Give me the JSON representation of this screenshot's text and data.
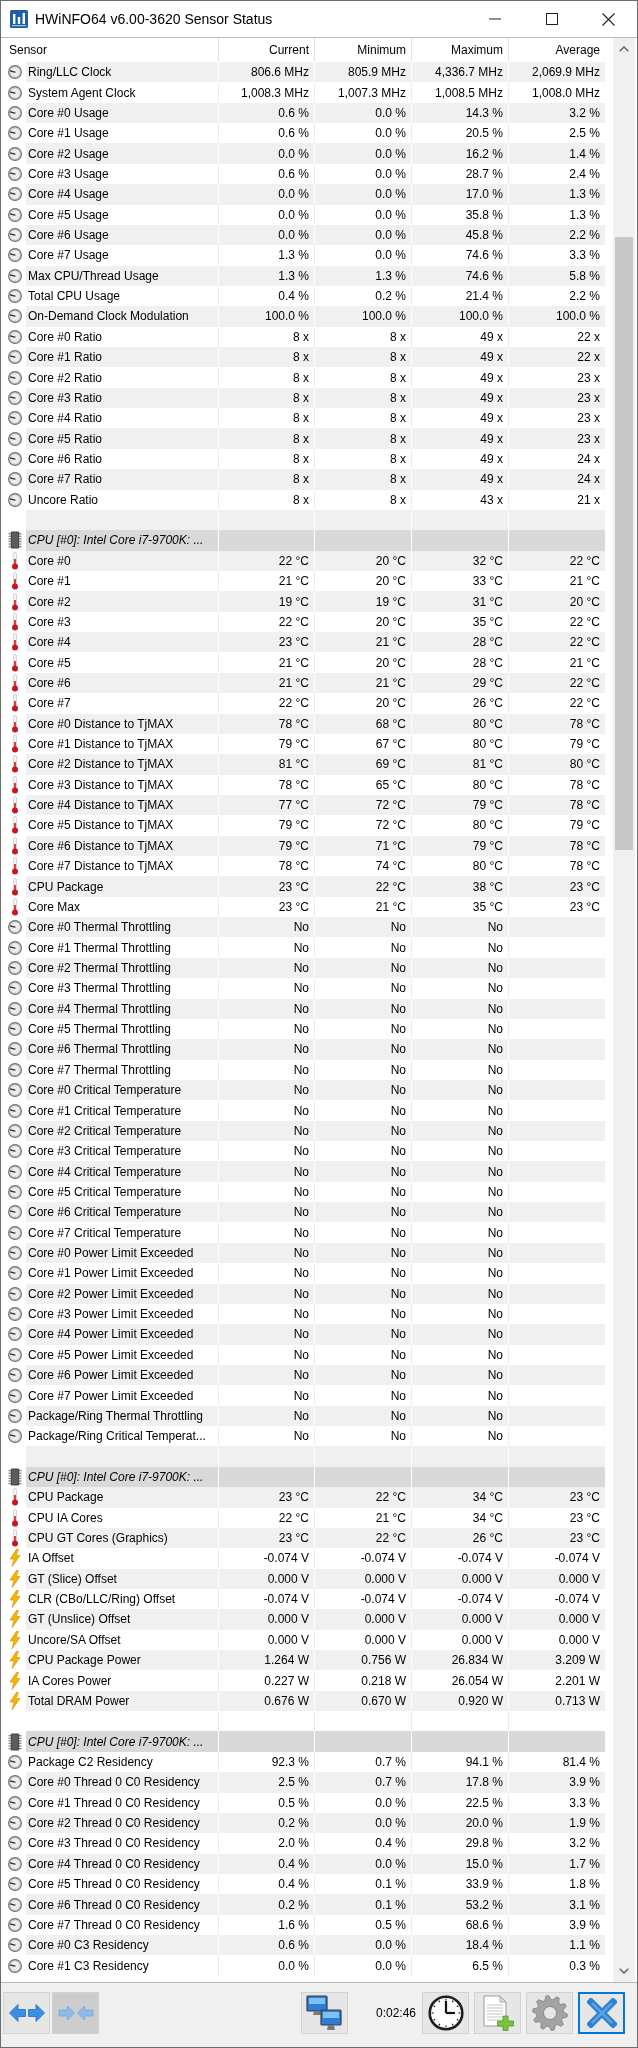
{
  "window": {
    "title": "HWiNFO64 v6.00-3620 Sensor Status"
  },
  "table": {
    "columns": [
      "Sensor",
      "Current",
      "Minimum",
      "Maximum",
      "Average"
    ],
    "sections": [
      {
        "rows": [
          {
            "kind": "gauge",
            "sensor": "Ring/LLC Clock",
            "values": [
              "806.6 MHz",
              "805.9 MHz",
              "4,336.7 MHz",
              "2,069.9 MHz"
            ]
          },
          {
            "kind": "gauge",
            "sensor": "System Agent Clock",
            "values": [
              "1,008.3 MHz",
              "1,007.3 MHz",
              "1,008.5 MHz",
              "1,008.0 MHz"
            ]
          },
          {
            "kind": "gauge",
            "sensor": "Core #0 Usage",
            "values": [
              "0.6 %",
              "0.0 %",
              "14.3 %",
              "3.2 %"
            ]
          },
          {
            "kind": "gauge",
            "sensor": "Core #1 Usage",
            "values": [
              "0.6 %",
              "0.0 %",
              "20.5 %",
              "2.5 %"
            ]
          },
          {
            "kind": "gauge",
            "sensor": "Core #2 Usage",
            "values": [
              "0.0 %",
              "0.0 %",
              "16.2 %",
              "1.4 %"
            ]
          },
          {
            "kind": "gauge",
            "sensor": "Core #3 Usage",
            "values": [
              "0.6 %",
              "0.0 %",
              "28.7 %",
              "2.4 %"
            ]
          },
          {
            "kind": "gauge",
            "sensor": "Core #4 Usage",
            "values": [
              "0.0 %",
              "0.0 %",
              "17.0 %",
              "1.3 %"
            ]
          },
          {
            "kind": "gauge",
            "sensor": "Core #5 Usage",
            "values": [
              "0.0 %",
              "0.0 %",
              "35.8 %",
              "1.3 %"
            ]
          },
          {
            "kind": "gauge",
            "sensor": "Core #6 Usage",
            "values": [
              "0.0 %",
              "0.0 %",
              "45.8 %",
              "2.2 %"
            ]
          },
          {
            "kind": "gauge",
            "sensor": "Core #7 Usage",
            "values": [
              "1.3 %",
              "0.0 %",
              "74.6 %",
              "3.3 %"
            ]
          },
          {
            "kind": "gauge",
            "sensor": "Max CPU/Thread Usage",
            "values": [
              "1.3 %",
              "1.3 %",
              "74.6 %",
              "5.8 %"
            ]
          },
          {
            "kind": "gauge",
            "sensor": "Total CPU Usage",
            "values": [
              "0.4 %",
              "0.2 %",
              "21.4 %",
              "2.2 %"
            ]
          },
          {
            "kind": "gauge",
            "sensor": "On-Demand Clock Modulation",
            "values": [
              "100.0 %",
              "100.0 %",
              "100.0 %",
              "100.0 %"
            ]
          },
          {
            "kind": "gauge",
            "sensor": "Core #0 Ratio",
            "values": [
              "8 x",
              "8 x",
              "49 x",
              "22 x"
            ]
          },
          {
            "kind": "gauge",
            "sensor": "Core #1 Ratio",
            "values": [
              "8 x",
              "8 x",
              "49 x",
              "22 x"
            ]
          },
          {
            "kind": "gauge",
            "sensor": "Core #2 Ratio",
            "values": [
              "8 x",
              "8 x",
              "49 x",
              "23 x"
            ]
          },
          {
            "kind": "gauge",
            "sensor": "Core #3 Ratio",
            "values": [
              "8 x",
              "8 x",
              "49 x",
              "23 x"
            ]
          },
          {
            "kind": "gauge",
            "sensor": "Core #4 Ratio",
            "values": [
              "8 x",
              "8 x",
              "49 x",
              "23 x"
            ]
          },
          {
            "kind": "gauge",
            "sensor": "Core #5 Ratio",
            "values": [
              "8 x",
              "8 x",
              "49 x",
              "23 x"
            ]
          },
          {
            "kind": "gauge",
            "sensor": "Core #6 Ratio",
            "values": [
              "8 x",
              "8 x",
              "49 x",
              "24 x"
            ]
          },
          {
            "kind": "gauge",
            "sensor": "Core #7 Ratio",
            "values": [
              "8 x",
              "8 x",
              "49 x",
              "24 x"
            ]
          },
          {
            "kind": "gauge",
            "sensor": "Uncore Ratio",
            "values": [
              "8 x",
              "8 x",
              "43 x",
              "21 x"
            ]
          }
        ]
      },
      {
        "title": "CPU [#0]: Intel Core i7-9700K: ...",
        "rows": [
          {
            "kind": "temperature",
            "sensor": "Core #0",
            "values": [
              "22 °C",
              "20 °C",
              "32 °C",
              "22 °C"
            ]
          },
          {
            "kind": "temperature",
            "sensor": "Core #1",
            "values": [
              "21 °C",
              "20 °C",
              "33 °C",
              "21 °C"
            ]
          },
          {
            "kind": "temperature",
            "sensor": "Core #2",
            "values": [
              "19 °C",
              "19 °C",
              "31 °C",
              "20 °C"
            ]
          },
          {
            "kind": "temperature",
            "sensor": "Core #3",
            "values": [
              "22 °C",
              "20 °C",
              "35 °C",
              "22 °C"
            ]
          },
          {
            "kind": "temperature",
            "sensor": "Core #4",
            "values": [
              "23 °C",
              "21 °C",
              "28 °C",
              "22 °C"
            ]
          },
          {
            "kind": "temperature",
            "sensor": "Core #5",
            "values": [
              "21 °C",
              "20 °C",
              "28 °C",
              "21 °C"
            ]
          },
          {
            "kind": "temperature",
            "sensor": "Core #6",
            "values": [
              "21 °C",
              "21 °C",
              "29 °C",
              "22 °C"
            ]
          },
          {
            "kind": "temperature",
            "sensor": "Core #7",
            "values": [
              "22 °C",
              "20 °C",
              "26 °C",
              "22 °C"
            ]
          },
          {
            "kind": "temperature",
            "sensor": "Core #0 Distance to TjMAX",
            "values": [
              "78 °C",
              "68 °C",
              "80 °C",
              "78 °C"
            ]
          },
          {
            "kind": "temperature",
            "sensor": "Core #1 Distance to TjMAX",
            "values": [
              "79 °C",
              "67 °C",
              "80 °C",
              "79 °C"
            ]
          },
          {
            "kind": "temperature",
            "sensor": "Core #2 Distance to TjMAX",
            "values": [
              "81 °C",
              "69 °C",
              "81 °C",
              "80 °C"
            ]
          },
          {
            "kind": "temperature",
            "sensor": "Core #3 Distance to TjMAX",
            "values": [
              "78 °C",
              "65 °C",
              "80 °C",
              "78 °C"
            ]
          },
          {
            "kind": "temperature",
            "sensor": "Core #4 Distance to TjMAX",
            "values": [
              "77 °C",
              "72 °C",
              "79 °C",
              "78 °C"
            ]
          },
          {
            "kind": "temperature",
            "sensor": "Core #5 Distance to TjMAX",
            "values": [
              "79 °C",
              "72 °C",
              "80 °C",
              "79 °C"
            ]
          },
          {
            "kind": "temperature",
            "sensor": "Core #6 Distance to TjMAX",
            "values": [
              "79 °C",
              "71 °C",
              "79 °C",
              "78 °C"
            ]
          },
          {
            "kind": "temperature",
            "sensor": "Core #7 Distance to TjMAX",
            "values": [
              "78 °C",
              "74 °C",
              "80 °C",
              "78 °C"
            ]
          },
          {
            "kind": "temperature",
            "sensor": "CPU Package",
            "values": [
              "23 °C",
              "22 °C",
              "38 °C",
              "23 °C"
            ]
          },
          {
            "kind": "temperature",
            "sensor": "Core Max",
            "values": [
              "23 °C",
              "21 °C",
              "35 °C",
              "23 °C"
            ]
          },
          {
            "kind": "gauge",
            "sensor": "Core #0 Thermal Throttling",
            "values": [
              "No",
              "No",
              "No"
            ]
          },
          {
            "kind": "gauge",
            "sensor": "Core #1 Thermal Throttling",
            "values": [
              "No",
              "No",
              "No"
            ]
          },
          {
            "kind": "gauge",
            "sensor": "Core #2 Thermal Throttling",
            "values": [
              "No",
              "No",
              "No"
            ]
          },
          {
            "kind": "gauge",
            "sensor": "Core #3 Thermal Throttling",
            "values": [
              "No",
              "No",
              "No"
            ]
          },
          {
            "kind": "gauge",
            "sensor": "Core #4 Thermal Throttling",
            "values": [
              "No",
              "No",
              "No"
            ]
          },
          {
            "kind": "gauge",
            "sensor": "Core #5 Thermal Throttling",
            "values": [
              "No",
              "No",
              "No"
            ]
          },
          {
            "kind": "gauge",
            "sensor": "Core #6 Thermal Throttling",
            "values": [
              "No",
              "No",
              "No"
            ]
          },
          {
            "kind": "gauge",
            "sensor": "Core #7 Thermal Throttling",
            "values": [
              "No",
              "No",
              "No"
            ]
          },
          {
            "kind": "gauge",
            "sensor": "Core #0 Critical Temperature",
            "values": [
              "No",
              "No",
              "No"
            ]
          },
          {
            "kind": "gauge",
            "sensor": "Core #1 Critical Temperature",
            "values": [
              "No",
              "No",
              "No"
            ]
          },
          {
            "kind": "gauge",
            "sensor": "Core #2 Critical Temperature",
            "values": [
              "No",
              "No",
              "No"
            ]
          },
          {
            "kind": "gauge",
            "sensor": "Core #3 Critical Temperature",
            "values": [
              "No",
              "No",
              "No"
            ]
          },
          {
            "kind": "gauge",
            "sensor": "Core #4 Critical Temperature",
            "values": [
              "No",
              "No",
              "No"
            ]
          },
          {
            "kind": "gauge",
            "sensor": "Core #5 Critical Temperature",
            "values": [
              "No",
              "No",
              "No"
            ]
          },
          {
            "kind": "gauge",
            "sensor": "Core #6 Critical Temperature",
            "values": [
              "No",
              "No",
              "No"
            ]
          },
          {
            "kind": "gauge",
            "sensor": "Core #7 Critical Temperature",
            "values": [
              "No",
              "No",
              "No"
            ]
          },
          {
            "kind": "gauge",
            "sensor": "Core #0 Power Limit Exceeded",
            "values": [
              "No",
              "No",
              "No"
            ]
          },
          {
            "kind": "gauge",
            "sensor": "Core #1 Power Limit Exceeded",
            "values": [
              "No",
              "No",
              "No"
            ]
          },
          {
            "kind": "gauge",
            "sensor": "Core #2 Power Limit Exceeded",
            "values": [
              "No",
              "No",
              "No"
            ]
          },
          {
            "kind": "gauge",
            "sensor": "Core #3 Power Limit Exceeded",
            "values": [
              "No",
              "No",
              "No"
            ]
          },
          {
            "kind": "gauge",
            "sensor": "Core #4 Power Limit Exceeded",
            "values": [
              "No",
              "No",
              "No"
            ]
          },
          {
            "kind": "gauge",
            "sensor": "Core #5 Power Limit Exceeded",
            "values": [
              "No",
              "No",
              "No"
            ]
          },
          {
            "kind": "gauge",
            "sensor": "Core #6 Power Limit Exceeded",
            "values": [
              "No",
              "No",
              "No"
            ]
          },
          {
            "kind": "gauge",
            "sensor": "Core #7 Power Limit Exceeded",
            "values": [
              "No",
              "No",
              "No"
            ]
          },
          {
            "kind": "gauge",
            "sensor": "Package/Ring Thermal Throttling",
            "values": [
              "No",
              "No",
              "No"
            ]
          },
          {
            "kind": "gauge",
            "sensor": "Package/Ring Critical Temperat...",
            "values": [
              "No",
              "No",
              "No"
            ]
          }
        ]
      },
      {
        "title": "CPU [#0]: Intel Core i7-9700K: ...",
        "rows": [
          {
            "kind": "temperature",
            "sensor": "CPU Package",
            "values": [
              "23 °C",
              "22 °C",
              "34 °C",
              "23 °C"
            ]
          },
          {
            "kind": "temperature",
            "sensor": "CPU IA Cores",
            "values": [
              "22 °C",
              "21 °C",
              "34 °C",
              "23 °C"
            ]
          },
          {
            "kind": "temperature",
            "sensor": "CPU GT Cores (Graphics)",
            "values": [
              "23 °C",
              "22 °C",
              "26 °C",
              "23 °C"
            ]
          },
          {
            "kind": "power",
            "sensor": "IA Offset",
            "values": [
              "-0.074 V",
              "-0.074 V",
              "-0.074 V",
              "-0.074 V"
            ]
          },
          {
            "kind": "power",
            "sensor": "GT (Slice) Offset",
            "values": [
              "0.000 V",
              "0.000 V",
              "0.000 V",
              "0.000 V"
            ]
          },
          {
            "kind": "power",
            "sensor": "CLR (CBo/LLC/Ring) Offset",
            "values": [
              "-0.074 V",
              "-0.074 V",
              "-0.074 V",
              "-0.074 V"
            ]
          },
          {
            "kind": "power",
            "sensor": "GT (Unslice) Offset",
            "values": [
              "0.000 V",
              "0.000 V",
              "0.000 V",
              "0.000 V"
            ]
          },
          {
            "kind": "power",
            "sensor": "Uncore/SA Offset",
            "values": [
              "0.000 V",
              "0.000 V",
              "0.000 V",
              "0.000 V"
            ]
          },
          {
            "kind": "power",
            "sensor": "CPU Package Power",
            "values": [
              "1.264 W",
              "0.756 W",
              "26.834 W",
              "3.209 W"
            ]
          },
          {
            "kind": "power",
            "sensor": "IA Cores Power",
            "values": [
              "0.227 W",
              "0.218 W",
              "26.054 W",
              "2.201 W"
            ]
          },
          {
            "kind": "power",
            "sensor": "Total DRAM Power",
            "values": [
              "0.676 W",
              "0.670 W",
              "0.920 W",
              "0.713 W"
            ]
          }
        ]
      },
      {
        "title": "CPU [#0]: Intel Core i7-9700K: ...",
        "rows": [
          {
            "kind": "gauge",
            "sensor": "Package C2 Residency",
            "values": [
              "92.3 %",
              "0.7 %",
              "94.1 %",
              "81.4 %"
            ]
          },
          {
            "kind": "gauge",
            "sensor": "Core #0 Thread 0 C0 Residency",
            "values": [
              "2.5 %",
              "0.7 %",
              "17.8 %",
              "3.9 %"
            ]
          },
          {
            "kind": "gauge",
            "sensor": "Core #1 Thread 0 C0 Residency",
            "values": [
              "0.5 %",
              "0.0 %",
              "22.5 %",
              "3.3 %"
            ]
          },
          {
            "kind": "gauge",
            "sensor": "Core #2 Thread 0 C0 Residency",
            "values": [
              "0.2 %",
              "0.0 %",
              "20.0 %",
              "1.9 %"
            ]
          },
          {
            "kind": "gauge",
            "sensor": "Core #3 Thread 0 C0 Residency",
            "values": [
              "2.0 %",
              "0.4 %",
              "29.8 %",
              "3.2 %"
            ]
          },
          {
            "kind": "gauge",
            "sensor": "Core #4 Thread 0 C0 Residency",
            "values": [
              "0.4 %",
              "0.0 %",
              "15.0 %",
              "1.7 %"
            ]
          },
          {
            "kind": "gauge",
            "sensor": "Core #5 Thread 0 C0 Residency",
            "values": [
              "0.4 %",
              "0.1 %",
              "33.9 %",
              "1.8 %"
            ]
          },
          {
            "kind": "gauge",
            "sensor": "Core #6 Thread 0 C0 Residency",
            "values": [
              "0.2 %",
              "0.1 %",
              "53.2 %",
              "3.1 %"
            ]
          },
          {
            "kind": "gauge",
            "sensor": "Core #7 Thread 0 C0 Residency",
            "values": [
              "1.6 %",
              "0.5 %",
              "68.6 %",
              "3.9 %"
            ]
          },
          {
            "kind": "gauge",
            "sensor": "Core #0 C3 Residency",
            "values": [
              "0.6 %",
              "0.0 %",
              "18.4 %",
              "1.1 %"
            ]
          },
          {
            "kind": "gauge",
            "sensor": "Core #1 C3 Residency",
            "values": [
              "0.0 %",
              "0.0 %",
              "6.5 %",
              "0.3 %"
            ]
          }
        ]
      }
    ]
  },
  "toolbar": {
    "left_buttons": [
      {
        "kind": "expand",
        "pressed": false,
        "focused": false
      },
      {
        "kind": "collapse",
        "pressed": true,
        "focused": false
      }
    ],
    "middle_buttons": [
      {
        "kind": "network",
        "pressed": false,
        "focused": false
      }
    ],
    "timer": "0:02:46",
    "right_buttons": [
      {
        "kind": "clock",
        "pressed": false,
        "focused": false
      },
      {
        "kind": "report",
        "pressed": false,
        "focused": false
      },
      {
        "kind": "settings",
        "pressed": false,
        "focused": false
      },
      {
        "kind": "close",
        "pressed": false,
        "focused": true
      }
    ]
  }
}
